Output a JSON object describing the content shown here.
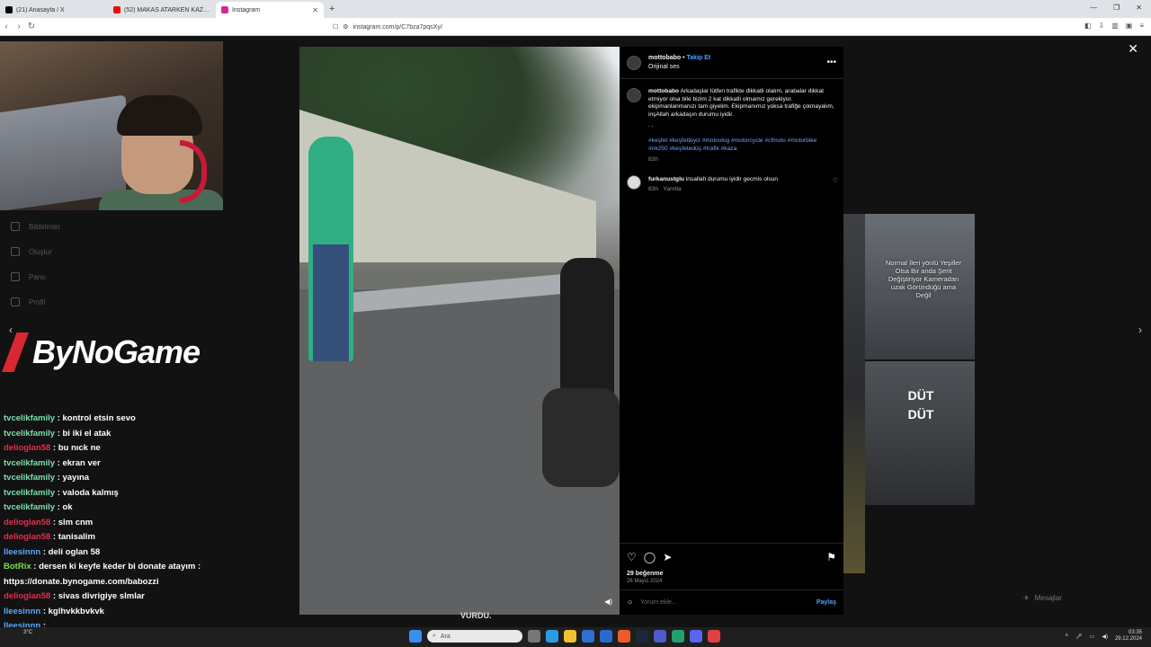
{
  "browser": {
    "tabs": [
      {
        "title": "(21) Anasayfa / X",
        "color": "#000000",
        "active": false
      },
      {
        "title": "(52) MAKAS ATARKEN KAZA! Türkiye",
        "color": "#ff0000",
        "active": false
      },
      {
        "title": "Instagram",
        "color": "#d6249f",
        "active": true
      }
    ],
    "new_tab": "+",
    "url": "instagram.com/p/C7bza7pqsXy/"
  },
  "stream": {
    "logo_text": "ByNoGame",
    "side_nav": [
      "Bildirimler",
      "Oluştur",
      "Pano",
      "Profil"
    ],
    "chat": [
      {
        "user": "tvcelikfamily",
        "color": "#7cdfb0",
        "text": ": kontrol etsin sevo"
      },
      {
        "user": "tvcelikfamily",
        "color": "#7cdfb0",
        "text": ": bi iki el atak"
      },
      {
        "user": "delioglan58",
        "color": "#e0304a",
        "text": ": bu nıck ne"
      },
      {
        "user": "tvcelikfamily",
        "color": "#7cdfb0",
        "text": ": ekran ver"
      },
      {
        "user": "tvcelikfamily",
        "color": "#7cdfb0",
        "text": ": yayına"
      },
      {
        "user": "tvcelikfamily",
        "color": "#7cdfb0",
        "text": ": valoda kalmış"
      },
      {
        "user": "tvcelikfamily",
        "color": "#7cdfb0",
        "text": ": ok"
      },
      {
        "user": "delioglan58",
        "color": "#e0304a",
        "text": ": slm cnm"
      },
      {
        "user": "delioglan58",
        "color": "#e0304a",
        "text": ": tanisalim"
      },
      {
        "user": "lleesinnn",
        "color": "#5aa9ff",
        "text": ": deli oglan 58"
      },
      {
        "user": "BotRix",
        "color": "#7cdf4a",
        "text": ": dersen ki keyfe keder bi donate atayım :"
      },
      {
        "user": "",
        "color": "#ffffff",
        "text": "https://donate.bynogame.com/babozzi"
      },
      {
        "user": "delioglan58",
        "color": "#e0304a",
        "text": ": sivas divrigiye slmlar"
      },
      {
        "user": "lleesinnn",
        "color": "#5aa9ff",
        "text": ": kglhvkkbvkvk"
      },
      {
        "user": "lleesinnn",
        "color": "#5aa9ff",
        "text": ":"
      }
    ]
  },
  "post": {
    "username": "mottobabo",
    "follow_label": "Takip Et",
    "separator": "•",
    "audio": "Orijinal ses",
    "caption": "Arkadaşlar lütfen trafikte dikkatli olalım, arabalar dikkat etmiyor olsa bile bizim 2 kat dikkatli olmamız gerekiyor. ekipmanlanmanızı tam giyelim. Ekipmanımız yoksa trafiğe çıkmayalım, inşAllah arkadaşın durumu iyidir.",
    "caption_dots": ". .",
    "hashtags": "#keşfet #keşfetteyiz #motovlog #motorcycle #cfmoto #motorbike #nk250 #keşfetedüş #trafik #kaza",
    "caption_time": "83h",
    "comment": {
      "user": "furkanustglu",
      "text": "insallah durumu iyidir gecmis olsun",
      "time": "83h",
      "reply": "Yanıtla"
    },
    "likes": "29 beğenme",
    "date": "26 Mayıs 2024",
    "comment_placeholder": "Yorum ekle...",
    "share_label": "Paylaş",
    "video_subtitle": "VURDU."
  },
  "reels": {
    "reel1_text": "Normal İleri yönlü Yeşiller Olsa Bir anda Şerit Değiştiriyor Kameradan uzak Göründüğü ama Değil",
    "reel2_text": "DÜT DÜT"
  },
  "messages_label": "Mesajlar",
  "taskbar": {
    "weather": "3°C",
    "search_placeholder": "Ara",
    "time": "03:35",
    "date": "29.12.2024"
  }
}
